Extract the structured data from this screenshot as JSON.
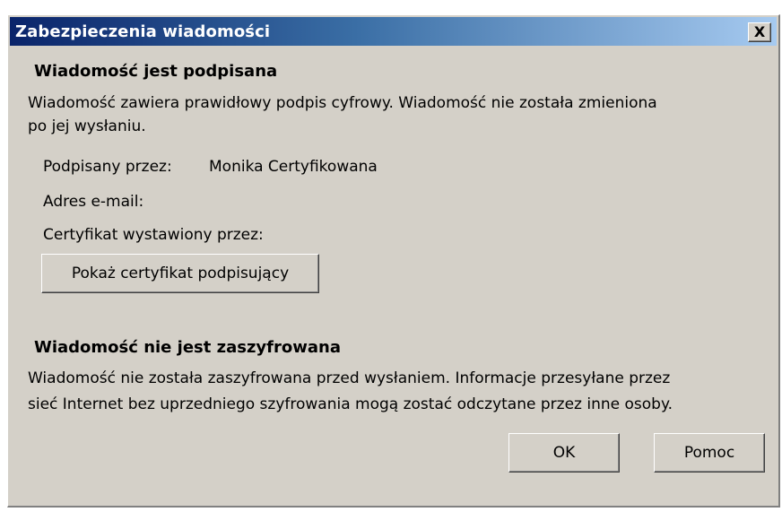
{
  "window": {
    "title": "Zabezpieczenia wiadomości",
    "close_label": "X"
  },
  "signed": {
    "heading": "Wiadomość jest podpisana",
    "desc_line1": "Wiadomość zawiera prawidłowy podpis cyfrowy. Wiadomość nie została zmieniona",
    "desc_line2": "po jej wysłaniu.",
    "signed_by_label": "Podpisany przez:",
    "signed_by_value": "Monika Certyfikowana",
    "email_label": "Adres e-mail:",
    "issuer_label": "Certyfikat wystawiony przez:",
    "show_cert_button": "Pokaż certyfikat podpisujący"
  },
  "encryption": {
    "heading": "Wiadomość nie jest zaszyfrowana",
    "desc_line1": "Wiadomość nie została zaszyfrowana przed wysłaniem. Informacje przesyłane przez",
    "desc_line2": "sieć Internet bez uprzedniego szyfrowania mogą zostać odczytane przez inne osoby."
  },
  "buttons": {
    "ok": "OK",
    "help": "Pomoc"
  },
  "colors": {
    "titlebar_start": "#0a246a",
    "titlebar_end": "#a6caf0",
    "face": "#d4d0c8"
  }
}
